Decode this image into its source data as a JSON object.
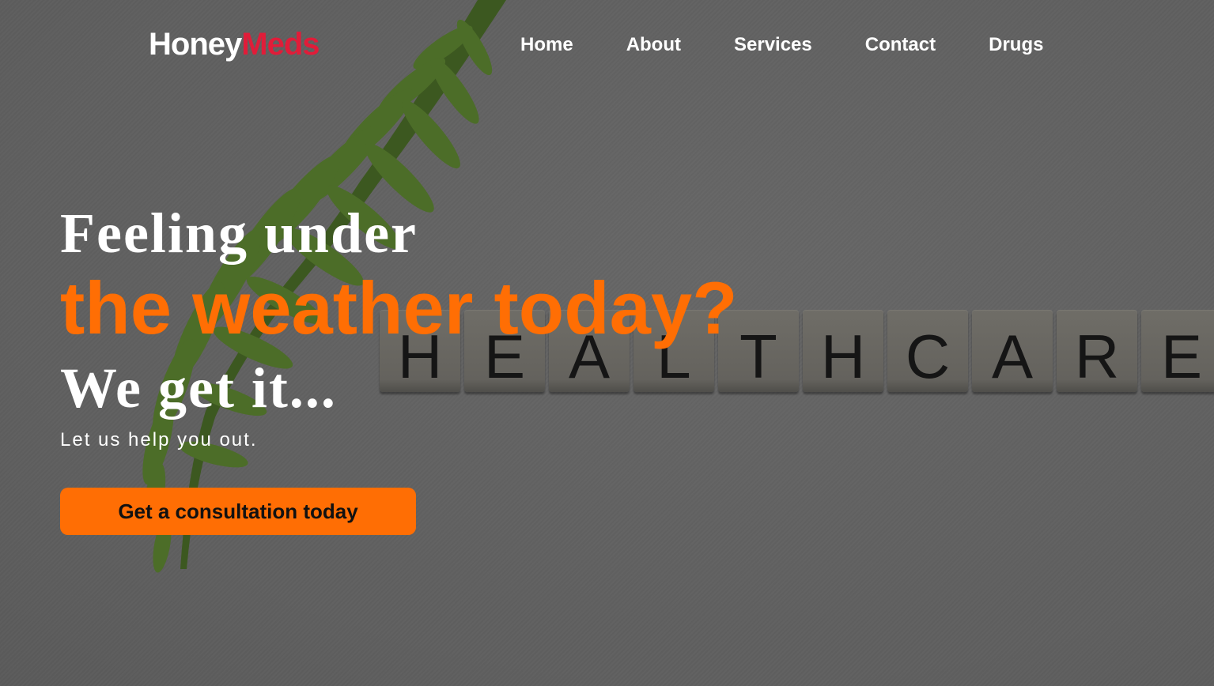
{
  "brand": {
    "part1": "Honey",
    "part2": "Meds",
    "color_part2": "#e11c39"
  },
  "nav": {
    "items": [
      {
        "label": "Home"
      },
      {
        "label": "About"
      },
      {
        "label": "Services"
      },
      {
        "label": "Contact"
      },
      {
        "label": "Drugs"
      }
    ]
  },
  "hero": {
    "line1": "Feeling under",
    "line2": "the weather today?",
    "line3": "We get it...",
    "subtitle": "Let us help you out.",
    "cta_label": "Get a consultation today",
    "accent_color": "#ff6e04"
  },
  "background": {
    "tiles": [
      "H",
      "E",
      "A",
      "L",
      "T",
      "H",
      "C",
      "A",
      "R",
      "E"
    ],
    "overlay_color": "#626262"
  }
}
